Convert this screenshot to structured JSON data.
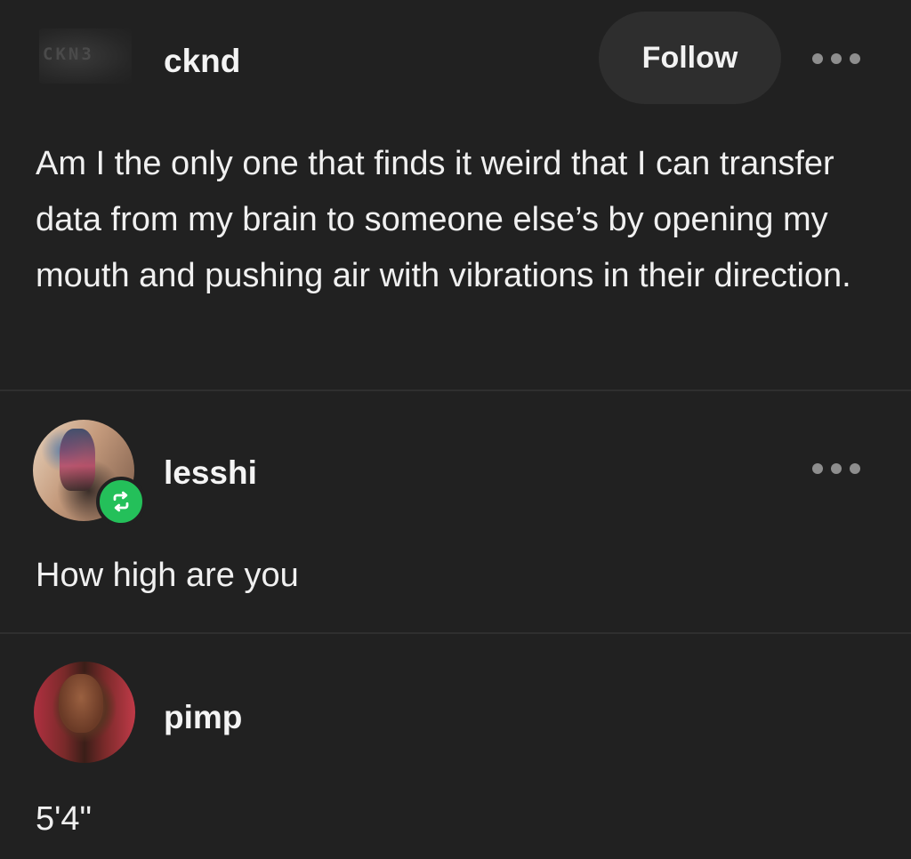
{
  "op": {
    "logo_text": "CKN3",
    "username": "cknd",
    "follow_label": "Follow",
    "more_icon": "more-horizontal-icon",
    "text": "Am I the only one that finds it weird that I can transfer data from my brain to someone else’s by opening my mouth and pushing air with vibrations in their direction."
  },
  "replies": [
    {
      "username": "lesshi",
      "text": "How high are you",
      "badge_icon": "reblog-icon",
      "badge_color": "#24c05a",
      "more_icon": "more-horizontal-icon"
    },
    {
      "username": "pimp",
      "text": "5'4\""
    }
  ],
  "colors": {
    "background": "#212121",
    "text": "#f2f2f2",
    "button": "#2e2e2e",
    "divider": "#2f2f2f"
  }
}
